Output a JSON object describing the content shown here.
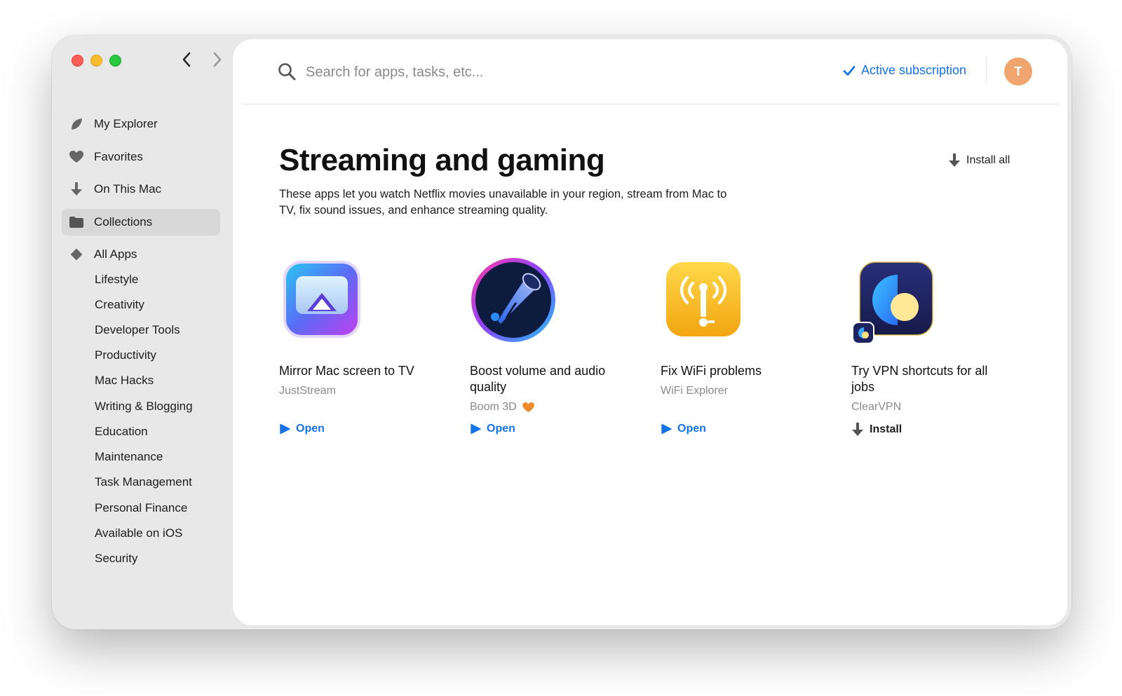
{
  "sidebar": {
    "primary": [
      {
        "label": "My Explorer",
        "icon": "leaf-icon"
      },
      {
        "label": "Favorites",
        "icon": "heart-icon"
      },
      {
        "label": "On This Mac",
        "icon": "download-arrow-icon"
      },
      {
        "label": "Collections",
        "icon": "folder-icon",
        "active": true
      },
      {
        "label": "All Apps",
        "icon": "diamond-icon"
      }
    ],
    "categories": [
      "Lifestyle",
      "Creativity",
      "Developer Tools",
      "Productivity",
      "Mac Hacks",
      "Writing & Blogging",
      "Education",
      "Maintenance",
      "Task Management",
      "Personal Finance",
      "Available on iOS",
      "Security"
    ]
  },
  "search": {
    "placeholder": "Search for apps, tasks, etc..."
  },
  "subscription": {
    "label": "Active subscription",
    "color": "#1573e6"
  },
  "user": {
    "initial": "T",
    "avatar_color": "#f0a56e"
  },
  "collection": {
    "title": "Streaming and gaming",
    "description": "These apps let you watch Netflix movies unavailable in your region, stream from Mac to TV, fix sound issues, and enhance streaming quality.",
    "install_all_label": "Install all"
  },
  "apps": [
    {
      "task": "Mirror Mac screen to TV",
      "app": "JustStream",
      "action": "Open",
      "icon": "juststream-icon"
    },
    {
      "task": "Boost volume and audio quality",
      "app": "Boom 3D",
      "favorite": true,
      "action": "Open",
      "icon": "boom3d-icon"
    },
    {
      "task": "Fix WiFi problems",
      "app": "WiFi Explorer",
      "action": "Open",
      "icon": "wifi-explorer-icon"
    },
    {
      "task": "Try VPN shortcuts for all jobs",
      "app": "ClearVPN",
      "action": "Install",
      "icon": "clearvpn-icon"
    }
  ]
}
